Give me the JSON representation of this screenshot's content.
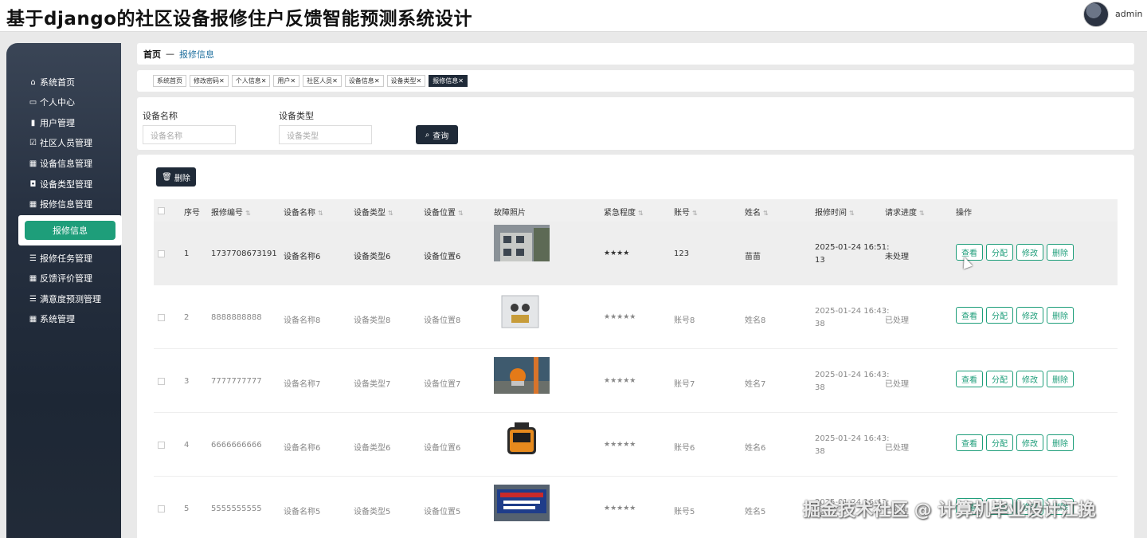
{
  "app": {
    "title": "基于django的社区设备报修住户反馈智能预测系统设计",
    "user": "admin"
  },
  "sidebar": {
    "items": [
      {
        "label": "系统首页",
        "icon": "home-icon"
      },
      {
        "label": "个人中心",
        "icon": "profile-icon"
      },
      {
        "label": "用户管理",
        "icon": "user-icon"
      },
      {
        "label": "社区人员管理",
        "icon": "check-icon"
      },
      {
        "label": "设备信息管理",
        "icon": "grid-icon"
      },
      {
        "label": "设备类型管理",
        "icon": "tag-icon"
      },
      {
        "label": "报修信息管理",
        "icon": "grid-icon"
      }
    ],
    "active": "报修信息",
    "items_after": [
      {
        "label": "报修任务管理",
        "icon": "list-icon"
      },
      {
        "label": "反馈评价管理",
        "icon": "grid-icon"
      },
      {
        "label": "满意度预测管理",
        "icon": "sliders-icon"
      },
      {
        "label": "系统管理",
        "icon": "grid-icon"
      }
    ]
  },
  "breadcrumb": {
    "home": "首页",
    "separator": "—",
    "current": "报修信息"
  },
  "tags": [
    "系统首页",
    "修改密码",
    "个人信息",
    "用户",
    "社区人员",
    "设备信息",
    "设备类型",
    "报修信息"
  ],
  "search": {
    "name_label": "设备名称",
    "name_placeholder": "设备名称",
    "type_label": "设备类型",
    "type_placeholder": "设备类型",
    "button": "查询"
  },
  "toolbar": {
    "delete_label": "删除"
  },
  "table": {
    "columns": [
      "序号",
      "报修编号",
      "设备名称",
      "设备类型",
      "设备位置",
      "故障照片",
      "紧急程度",
      "账号",
      "姓名",
      "报修时间",
      "请求进度",
      "操作"
    ],
    "rows": [
      {
        "seq": "1",
        "code": "1737708673191",
        "name": "设备名称6",
        "type": "设备类型6",
        "location": "设备位置6",
        "photo": "building",
        "urgency": "★★★★",
        "account": "123",
        "person": "苗苗",
        "time1": "2025-01-24 16:51:",
        "time2": "13",
        "status": "未处理"
      },
      {
        "seq": "2",
        "code": "8888888888",
        "name": "设备名称8",
        "type": "设备类型8",
        "location": "设备位置8",
        "photo": "cabinet",
        "urgency": "★★★★★",
        "account": "账号8",
        "person": "姓名8",
        "time1": "2025-01-24 16:43:",
        "time2": "38",
        "status": "已处理"
      },
      {
        "seq": "3",
        "code": "7777777777",
        "name": "设备名称7",
        "type": "设备类型7",
        "location": "设备位置7",
        "photo": "industrial",
        "urgency": "★★★★★",
        "account": "账号7",
        "person": "姓名7",
        "time1": "2025-01-24 16:43:",
        "time2": "38",
        "status": "已处理"
      },
      {
        "seq": "4",
        "code": "6666666666",
        "name": "设备名称6",
        "type": "设备类型6",
        "location": "设备位置6",
        "photo": "battery",
        "urgency": "★★★★★",
        "account": "账号6",
        "person": "姓名6",
        "time1": "2025-01-24 16:43:",
        "time2": "38",
        "status": "已处理"
      },
      {
        "seq": "5",
        "code": "5555555555",
        "name": "设备名称5",
        "type": "设备类型5",
        "location": "设备位置5",
        "photo": "sign",
        "urgency": "★★★★★",
        "account": "账号5",
        "person": "姓名5",
        "time1": "2025-01-24 16:43:",
        "time2": "38",
        "status": "已处理"
      }
    ],
    "actions": [
      "查看",
      "分配",
      "修改",
      "删除"
    ]
  },
  "watermark": "掘金技术社区 @ 计算机毕业设计江挽"
}
